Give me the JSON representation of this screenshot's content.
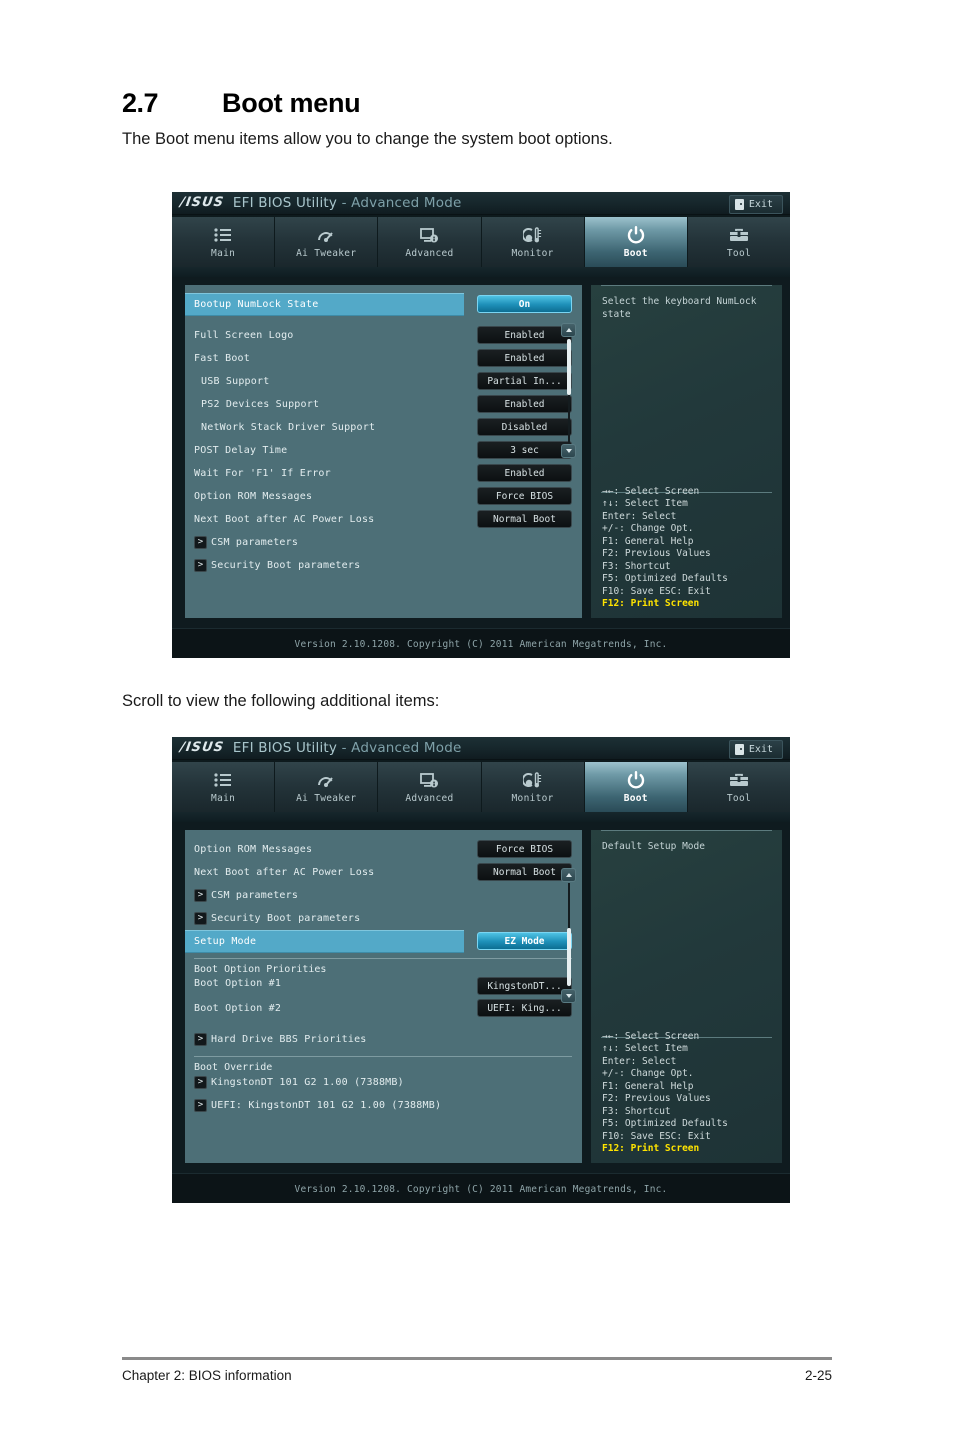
{
  "document": {
    "section_number": "2.7",
    "section_title": "Boot menu",
    "intro": "The Boot menu items allow you to change the system boot options.",
    "scroll_note": "Scroll to view the following additional items:",
    "footer_left": "Chapter 2: BIOS information",
    "footer_right": "2-25"
  },
  "bios_common": {
    "logo": "/ISUS",
    "title_main": "EFI BIOS Utility",
    "title_sep": " - ",
    "title_mode": "Advanced Mode",
    "exit_label": "Exit",
    "version_text": "Version 2.10.1208. Copyright (C) 2011 American Megatrends, Inc.",
    "tabs": [
      {
        "label": "Main",
        "icon": "list-icon",
        "active": false
      },
      {
        "label": "Ai Tweaker",
        "icon": "gauge-icon",
        "active": false
      },
      {
        "label": "Advanced",
        "icon": "monitor-info-icon",
        "active": false
      },
      {
        "label": "Monitor",
        "icon": "thermometer-icon",
        "active": false
      },
      {
        "label": "Boot",
        "icon": "power-icon",
        "active": true
      },
      {
        "label": "Tool",
        "icon": "toolbox-icon",
        "active": false
      }
    ],
    "legend": [
      "→←: Select Screen",
      "↑↓: Select Item",
      "Enter: Select",
      "+/-: Change Opt.",
      "F1: General Help",
      "F2: Previous Values",
      "F3: Shortcut",
      "F5: Optimized Defaults",
      "F10: Save  ESC: Exit"
    ],
    "legend_highlight": "F12: Print Screen",
    "accent_selected_row": "#53a9c8",
    "accent_active_value": "#1d8fb8",
    "accent_legend_highlight": "#ffe400"
  },
  "screen1": {
    "help_text": "Select the keyboard NumLock state",
    "rows": [
      {
        "label": "Bootup NumLock State",
        "value": "On",
        "selected": true,
        "value_active": true
      },
      {
        "label": "Full Screen Logo",
        "value": "Enabled"
      },
      {
        "label": "Fast Boot",
        "value": "Enabled"
      },
      {
        "label": "USB Support",
        "value": "Partial In...",
        "indent": true
      },
      {
        "label": "PS2 Devices Support",
        "value": "Enabled",
        "indent": true
      },
      {
        "label": "NetWork Stack Driver Support",
        "value": "Disabled",
        "indent": true
      },
      {
        "label": "POST Delay Time",
        "value": "3 sec"
      },
      {
        "label": "Wait For 'F1' If Error",
        "value": "Enabled"
      },
      {
        "label": "Option ROM Messages",
        "value": "Force BIOS"
      },
      {
        "label": "Next Boot after AC Power Loss",
        "value": "Normal Boot"
      },
      {
        "label": "CSM parameters",
        "submenu": true
      },
      {
        "label": "Security Boot parameters",
        "submenu": true
      }
    ]
  },
  "screen2": {
    "help_text": "Default Setup Mode",
    "rows": [
      {
        "label": "Option ROM Messages",
        "value": "Force BIOS"
      },
      {
        "label": "Next Boot after AC Power Loss",
        "value": "Normal Boot"
      },
      {
        "label": "CSM parameters",
        "submenu": true
      },
      {
        "label": "Security Boot parameters",
        "submenu": true
      },
      {
        "label": "Setup Mode",
        "value": "EZ Mode",
        "selected": true,
        "value_active": true
      }
    ],
    "boot_priorities_title": "Boot Option Priorities",
    "boot_priorities": [
      {
        "label": "Boot Option #1",
        "value": "KingstonDT..."
      },
      {
        "label": "Boot Option #2",
        "value": "UEFI: King..."
      }
    ],
    "hard_drive_bbs": "Hard Drive BBS Priorities",
    "boot_override_title": "Boot Override",
    "boot_override": [
      "KingstonDT 101 G2 1.00   (7388MB)",
      "UEFI: KingstonDT 101 G2 1.00  (7388MB)"
    ]
  }
}
